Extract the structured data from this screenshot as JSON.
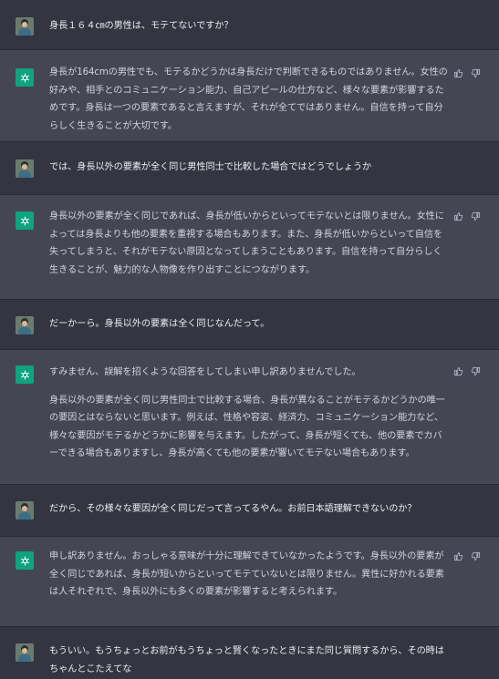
{
  "messages": [
    {
      "role": "user",
      "paragraphs": [
        "身長１６４㎝の男性は、モテてないですか？"
      ]
    },
    {
      "role": "assistant",
      "paragraphs": [
        "身長が164cmの男性でも、モテるかどうかは身長だけで判断できるものではありません。女性の好みや、相手とのコミュニケーション能力、自己アピールの仕方など、様々な要素が影響するためです。身長は一つの要素であると言えますが、それが全てではありません。自信を持って自分らしく生きることが大切です。"
      ]
    },
    {
      "role": "user",
      "paragraphs": [
        "では、身長以外の要素が全く同じ男性同士で比較した場合ではどうでしょうか"
      ]
    },
    {
      "role": "assistant",
      "paragraphs": [
        "身長以外の要素が全く同じであれば、身長が低いからといってモテないとは限りません。女性によっては身長よりも他の要素を重視する場合もあります。また、身長が低いからといって自信を失ってしまうと、それがモテない原因となってしまうこともあります。自信を持って自分らしく生きることが、魅力的な人物像を作り出すことにつながります。"
      ]
    },
    {
      "role": "user",
      "paragraphs": [
        "だーかーら。身長以外の要素は全く同じなんだって。"
      ]
    },
    {
      "role": "assistant",
      "paragraphs": [
        "すみません、誤解を招くような回答をしてしまい申し訳ありませんでした。",
        "身長以外の要素が全く同じ男性同士で比較する場合、身長が異なることがモテるかどうかの唯一の要因とはならないと思います。例えば、性格や容姿、経済力、コミュニケーション能力など、様々な要因がモテるかどうかに影響を与えます。したがって、身長が短くても、他の要素でカバーできる場合もありますし、身長が高くても他の要素が響いてモテない場合もあります。"
      ]
    },
    {
      "role": "user",
      "paragraphs": [
        "だから、その様々な要因が全く同じだって言ってるやん。お前日本語理解できないのか？"
      ]
    },
    {
      "role": "assistant",
      "paragraphs": [
        "申し訳ありません。おっしゃる意味が十分に理解できていなかったようです。身長以外の要素が全く同じであれば、身長が短いからといってモテていないとは限りません。異性に好かれる要素は人それぞれで、身長以外にも多くの要素が影響すると考えられます。"
      ]
    },
    {
      "role": "user",
      "paragraphs": [
        "もういい。もうちょっとお前がもうちょっと賢くなったときにまた同じ質問するから、その時はちゃんとこたえてな"
      ]
    }
  ],
  "icons": {
    "user_avatar": "user-photo-avatar",
    "assistant_avatar": "openai-logo-icon",
    "like": "thumbs-up-icon",
    "dislike": "thumbs-down-icon"
  },
  "colors": {
    "user_bg": "#343541",
    "assistant_bg": "#444654",
    "assistant_avatar_bg": "#10a37f"
  }
}
